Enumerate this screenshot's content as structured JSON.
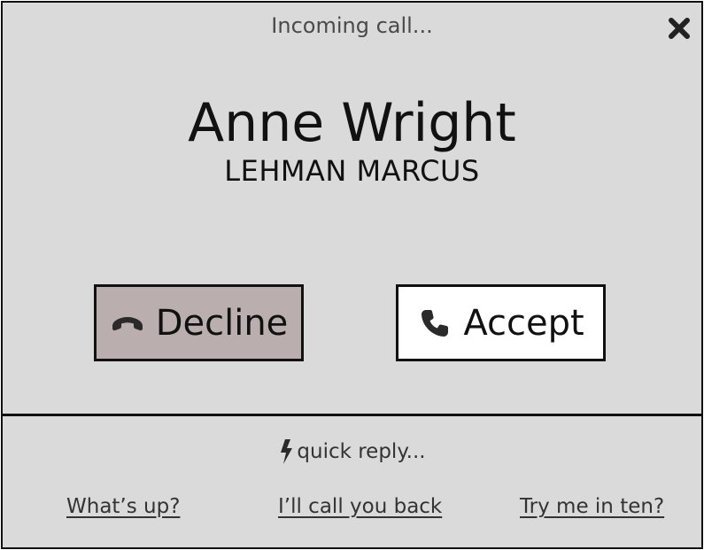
{
  "window": {
    "title": "Incoming call..."
  },
  "caller": {
    "name": "Anne Wright",
    "company": "LEHMAN MARCUS"
  },
  "actions": {
    "decline_label": "Decline",
    "accept_label": "Accept"
  },
  "quick_reply": {
    "label": "quick reply...",
    "options": [
      "What’s up?",
      "I’ll call you back",
      "Try me in ten?"
    ]
  },
  "icons": {
    "close": "close-icon",
    "decline": "hang-up-phone-icon",
    "accept": "phone-icon",
    "quick_reply": "lightning-bolt-icon"
  },
  "colors": {
    "background": "#dadada",
    "decline_button": "#baaeae",
    "accept_button": "#ffffff",
    "border": "#111111"
  }
}
